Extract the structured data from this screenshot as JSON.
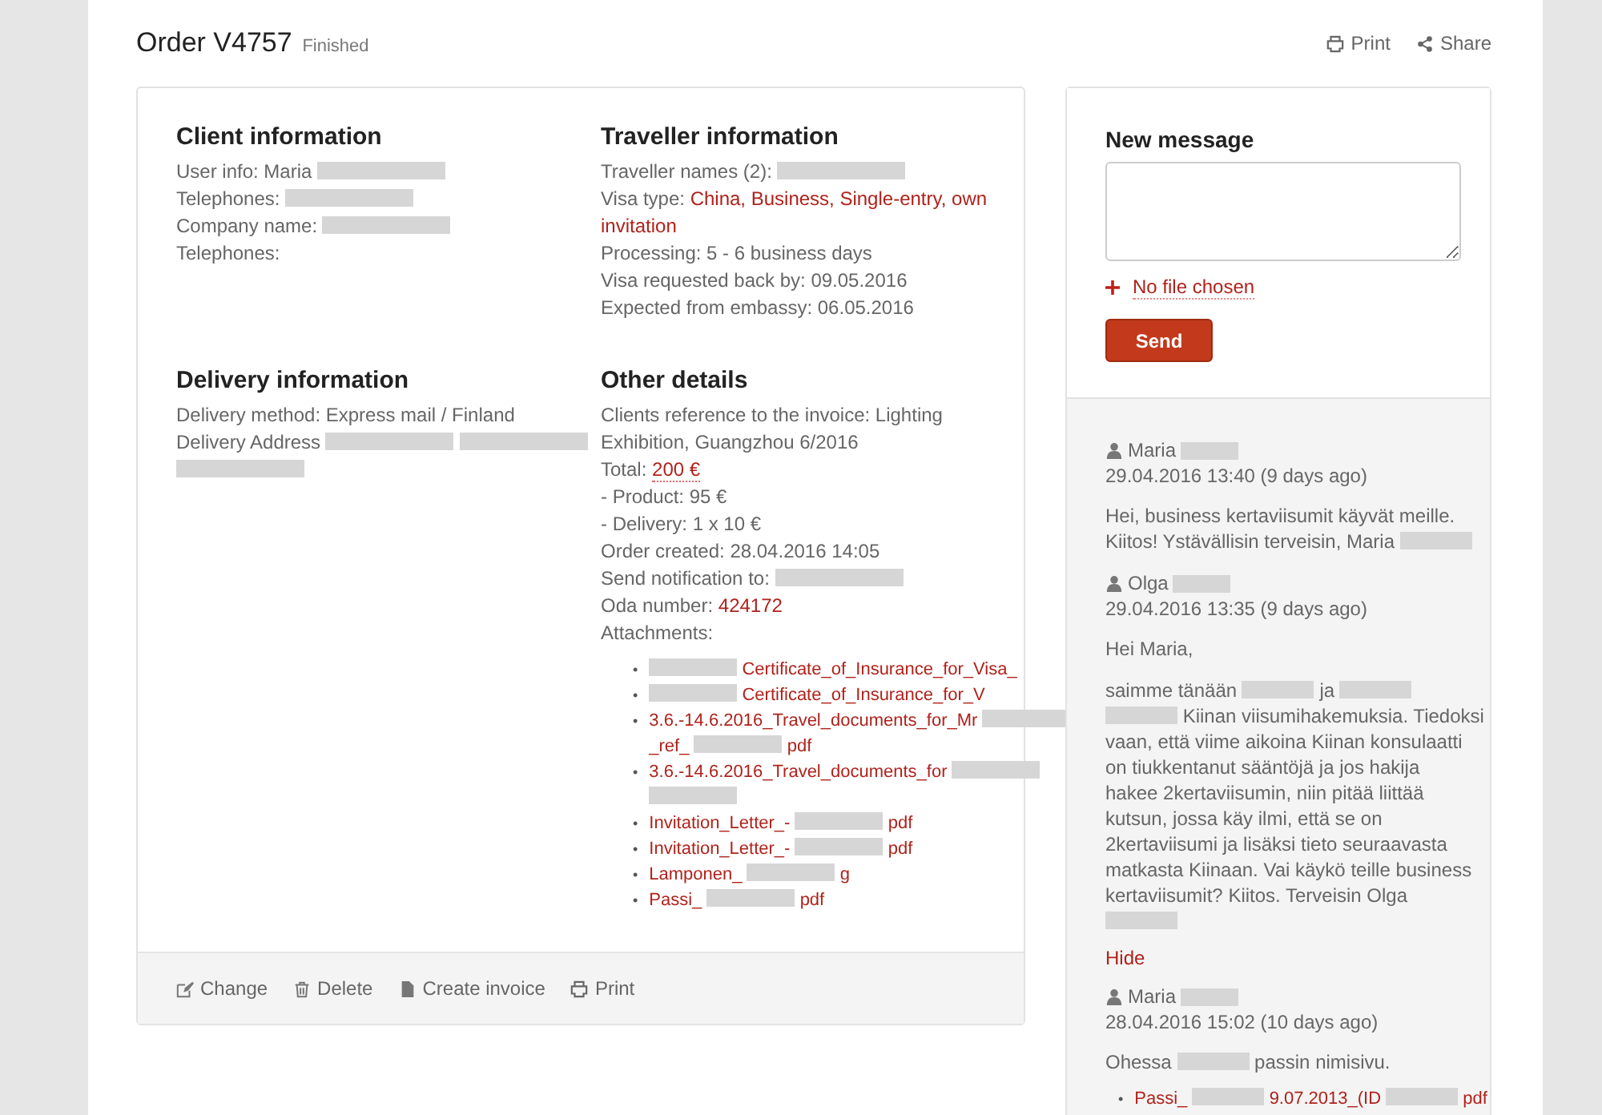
{
  "header": {
    "title": "Order V4757",
    "status": "Finished",
    "actions": [
      {
        "kind": "print",
        "label": "Print"
      },
      {
        "kind": "share",
        "label": "Share"
      }
    ]
  },
  "sections": [
    {
      "title": "Client information",
      "lines": [
        [
          {
            "kind": "text",
            "text": "User info: Maria"
          },
          {
            "kind": "redacted"
          }
        ],
        [
          {
            "kind": "text",
            "text": "Telephones:"
          },
          {
            "kind": "redacted"
          }
        ],
        [
          {
            "kind": "text",
            "text": "Company name:"
          },
          {
            "kind": "redacted"
          }
        ],
        [
          {
            "kind": "text",
            "text": "Telephones:"
          }
        ]
      ]
    },
    {
      "title": "Traveller information",
      "lines": [
        [
          {
            "kind": "text",
            "text": "Traveller names (2):"
          },
          {
            "kind": "redacted"
          }
        ],
        [
          {
            "kind": "text",
            "text": "Visa type:"
          },
          {
            "kind": "link",
            "text": "China, Business, Single-entry, own"
          }
        ],
        [
          {
            "kind": "link",
            "text": "invitation"
          }
        ],
        [
          {
            "kind": "text",
            "text": "Processing: 5 - 6 business days"
          }
        ],
        [
          {
            "kind": "text",
            "text": "Visa requested back by: 09.05.2016"
          }
        ],
        [
          {
            "kind": "text",
            "text": "Expected from embassy: 06.05.2016"
          }
        ]
      ]
    },
    {
      "title": "Delivery information",
      "lines": [
        [
          {
            "kind": "text",
            "text": "Delivery method: Express mail / Finland"
          }
        ],
        [
          {
            "kind": "text",
            "text": "Delivery Address"
          },
          {
            "kind": "redacted"
          },
          {
            "kind": "redacted"
          }
        ],
        [
          {
            "kind": "redacted"
          }
        ]
      ]
    },
    {
      "title": "Other details",
      "lines": [
        [
          {
            "kind": "text",
            "text": "Clients reference to the invoice: Lighting"
          }
        ],
        [
          {
            "kind": "text",
            "text": "Exhibition, Guangzhou 6/2016"
          }
        ],
        [
          {
            "kind": "text",
            "text": "Total:"
          },
          {
            "kind": "price",
            "text": "200 €"
          }
        ],
        [
          {
            "kind": "text",
            "text": "- Product: 95 €"
          }
        ],
        [
          {
            "kind": "text",
            "text": "- Delivery: 1 x 10 €"
          }
        ],
        [
          {
            "kind": "text",
            "text": "Order created: 28.04.2016 14:05"
          }
        ],
        [
          {
            "kind": "text",
            "text": "Send notification to:"
          },
          {
            "kind": "redacted"
          }
        ],
        [
          {
            "kind": "text",
            "text": "Oda number:"
          },
          {
            "kind": "link",
            "text": "424172"
          }
        ],
        [
          {
            "kind": "text",
            "text": "Attachments:"
          }
        ]
      ],
      "attachments": [
        {
          "bullet": "•",
          "lines": [
            [
              {
                "kind": "redacted"
              },
              {
                "kind": "link",
                "text": "Certificate_of_Insurance_for_Visa_"
              }
            ]
          ]
        },
        {
          "bullet": "•",
          "lines": [
            [
              {
                "kind": "redacted"
              },
              {
                "kind": "link",
                "text": "Certificate_of_Insurance_for_V"
              }
            ]
          ]
        },
        {
          "bullet": "•",
          "lines": [
            [
              {
                "kind": "link",
                "text": "3.6.-14.6.2016_Travel_documents_for_Mr"
              },
              {
                "kind": "redacted"
              }
            ],
            [
              {
                "kind": "link",
                "text": "_ref_"
              },
              {
                "kind": "redacted"
              },
              {
                "kind": "link",
                "text": "pdf"
              }
            ]
          ]
        },
        {
          "bullet": "•",
          "lines": [
            [
              {
                "kind": "link",
                "text": "3.6.-14.6.2016_Travel_documents_for"
              },
              {
                "kind": "redacted"
              }
            ],
            [
              {
                "kind": "redacted"
              }
            ]
          ]
        },
        {
          "bullet": "•",
          "lines": [
            [
              {
                "kind": "link",
                "text": "Invitation_Letter_-"
              },
              {
                "kind": "redacted"
              },
              {
                "kind": "link",
                "text": "pdf"
              }
            ]
          ]
        },
        {
          "bullet": "•",
          "lines": [
            [
              {
                "kind": "link",
                "text": "Invitation_Letter_-"
              },
              {
                "kind": "redacted"
              },
              {
                "kind": "link",
                "text": "pdf"
              }
            ]
          ]
        },
        {
          "bullet": "•",
          "lines": [
            [
              {
                "kind": "link",
                "text": "Lamponen_"
              },
              {
                "kind": "redacted"
              },
              {
                "kind": "link",
                "text": "g"
              }
            ]
          ]
        },
        {
          "bullet": "•",
          "lines": [
            [
              {
                "kind": "link",
                "text": "Passi_"
              },
              {
                "kind": "redacted"
              },
              {
                "kind": "link",
                "text": "pdf"
              }
            ]
          ]
        }
      ]
    }
  ],
  "footer_actions": [
    {
      "kind": "edit",
      "label": "Change"
    },
    {
      "kind": "delete",
      "label": "Delete"
    },
    {
      "kind": "file",
      "label": "Create invoice"
    },
    {
      "kind": "print",
      "label": "Print"
    }
  ],
  "new_message": {
    "title": "New message",
    "file_label": "No file chosen",
    "send": "Send"
  },
  "messages": [
    {
      "author": "Maria",
      "date": "29.04.2016 13:40 (9 days ago)",
      "paragraphs": [
        [
          [
            {
              "kind": "text",
              "text": "Hei, business kertaviisumit käyvät meille."
            }
          ],
          [
            {
              "kind": "text",
              "text": "Kiitos! Ystävällisin terveisin, Maria"
            },
            {
              "kind": "redacted"
            }
          ]
        ]
      ]
    },
    {
      "author": "Olga",
      "date": "29.04.2016 13:35 (9 days ago)",
      "paragraphs": [
        [
          [
            {
              "kind": "text",
              "text": "Hei Maria,"
            }
          ]
        ],
        [
          [
            {
              "kind": "text",
              "text": "saimme tänään"
            },
            {
              "kind": "redacted"
            },
            {
              "kind": "text",
              "text": "ja"
            },
            {
              "kind": "redacted"
            }
          ],
          [
            {
              "kind": "redacted"
            },
            {
              "kind": "text",
              "text": "Kiinan viisumihakemuksia. Tiedoksi"
            }
          ],
          [
            {
              "kind": "text",
              "text": "vaan, että viime aikoina Kiinan konsulaatti"
            }
          ],
          [
            {
              "kind": "text",
              "text": "on tiukkentanut sääntöjä ja jos hakija"
            }
          ],
          [
            {
              "kind": "text",
              "text": "hakee 2kertaviisumin, niin pitää liittää"
            }
          ],
          [
            {
              "kind": "text",
              "text": "kutsun, jossa käy ilmi, että se on"
            }
          ],
          [
            {
              "kind": "text",
              "text": "2kertaviisumi ja lisäksi tieto seuraavasta"
            }
          ],
          [
            {
              "kind": "text",
              "text": "matkasta Kiinaan. Vai käykö teille business"
            }
          ],
          [
            {
              "kind": "text",
              "text": "kertaviisumit? Kiitos. Terveisin Olga"
            }
          ],
          [
            {
              "kind": "redacted"
            }
          ]
        ]
      ],
      "hide": "Hide"
    },
    {
      "author": "Maria",
      "date": "28.04.2016 15:02 (10 days ago)",
      "paragraphs": [
        [
          [
            {
              "kind": "text",
              "text": "Ohessa"
            },
            {
              "kind": "redacted"
            },
            {
              "kind": "text",
              "text": "passin nimisivu."
            }
          ]
        ]
      ],
      "attachments": [
        {
          "bullet": "•",
          "lines": [
            [
              {
                "kind": "link",
                "text": "Passi_"
              },
              {
                "kind": "redacted"
              },
              {
                "kind": "link",
                "text": "9.07.2013_(ID"
              },
              {
                "kind": "redacted"
              },
              {
                "kind": "link",
                "text": "pdf"
              }
            ]
          ]
        }
      ]
    }
  ]
}
